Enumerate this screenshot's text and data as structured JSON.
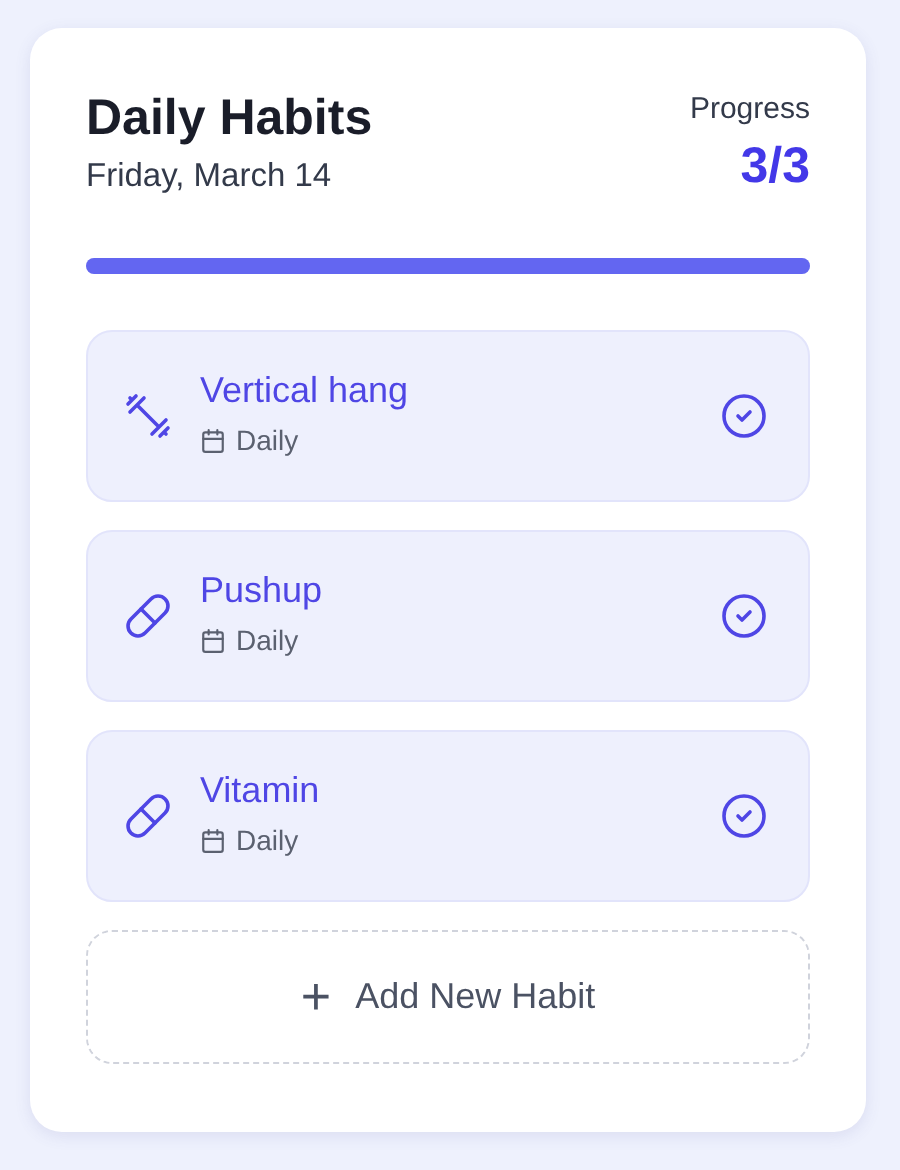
{
  "header": {
    "title": "Daily Habits",
    "date": "Friday, March 14",
    "progress_label": "Progress",
    "progress_count": "3/3",
    "level": 1
  },
  "habits": [
    {
      "name": "Vertical hang",
      "kind": "dumbbell",
      "frequency": "Daily",
      "completed": true
    },
    {
      "name": "Pushup",
      "kind": "pill",
      "frequency": "Daily",
      "completed": true
    },
    {
      "name": "Vitamin",
      "kind": "pill",
      "frequency": "Daily",
      "completed": true
    }
  ],
  "add_button": {
    "plus": "+",
    "label": "Add New Habit"
  }
}
